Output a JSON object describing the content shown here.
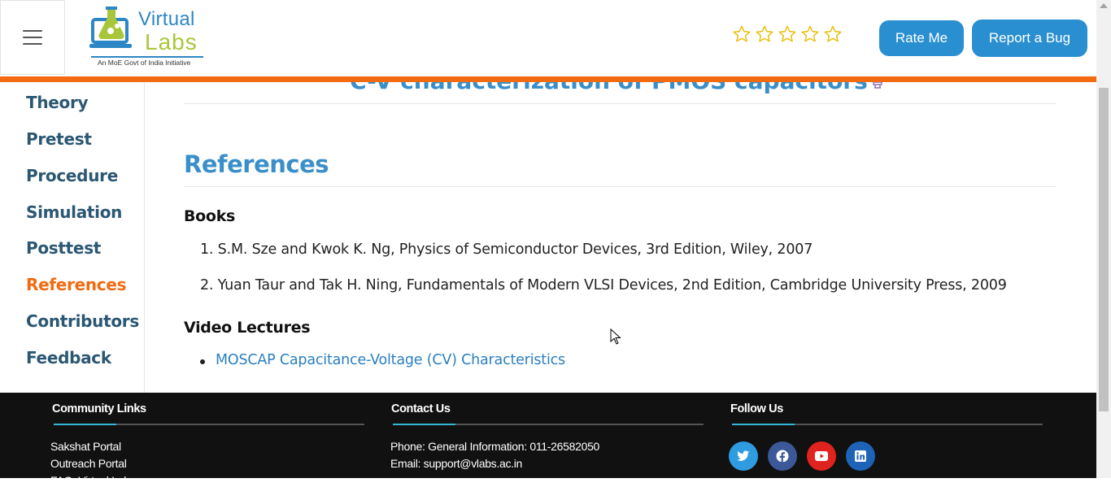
{
  "header": {
    "menu_icon": "hamburger-icon",
    "logo": {
      "word1": "Virtual",
      "word2": "Labs",
      "tagline": "An MoE Govt of India Initiative"
    },
    "rating": {
      "max": 5,
      "value": 0,
      "icon": "star-outline-icon",
      "color": "#e8c21a"
    },
    "rate_button": "Rate Me",
    "bug_button": "Report a Bug",
    "accent_color": "#f26b10",
    "button_color": "#2a8fd0"
  },
  "sidebar": {
    "items": [
      {
        "label": "Theory",
        "active": false
      },
      {
        "label": "Pretest",
        "active": false
      },
      {
        "label": "Procedure",
        "active": false
      },
      {
        "label": "Simulation",
        "active": false
      },
      {
        "label": "Posttest",
        "active": false
      },
      {
        "label": "References",
        "active": true
      },
      {
        "label": "Contributors",
        "active": false
      },
      {
        "label": "Feedback",
        "active": false
      }
    ]
  },
  "main": {
    "experiment_title": "C-V characterization of PMOS capacitors",
    "heading": "References",
    "books_heading": "Books",
    "books": [
      "S.M. Sze and Kwok K. Ng, Physics of Semiconductor Devices, 3rd Edition, Wiley, 2007",
      "Yuan Taur and Tak H. Ning, Fundamentals of Modern VLSI Devices, 2nd Edition, Cambridge University Press, 2009"
    ],
    "video_heading": "Video Lectures",
    "videos": [
      "MOSCAP Capacitance-Voltage (CV) Characteristics"
    ]
  },
  "footer": {
    "community": {
      "heading": "Community Links",
      "links": [
        "Sakshat Portal",
        "Outreach Portal",
        "FAQ: Virtual Labs"
      ]
    },
    "contact": {
      "heading": "Contact Us",
      "phone": "Phone: General Information: 011-26582050",
      "email": "Email: support@vlabs.ac.in"
    },
    "follow": {
      "heading": "Follow Us",
      "icons": [
        {
          "name": "twitter-icon",
          "color": "#2f9be0"
        },
        {
          "name": "facebook-icon",
          "color": "#3b5998"
        },
        {
          "name": "youtube-icon",
          "color": "#e0231e"
        },
        {
          "name": "linkedin-icon",
          "color": "#1e63b8"
        }
      ]
    }
  }
}
